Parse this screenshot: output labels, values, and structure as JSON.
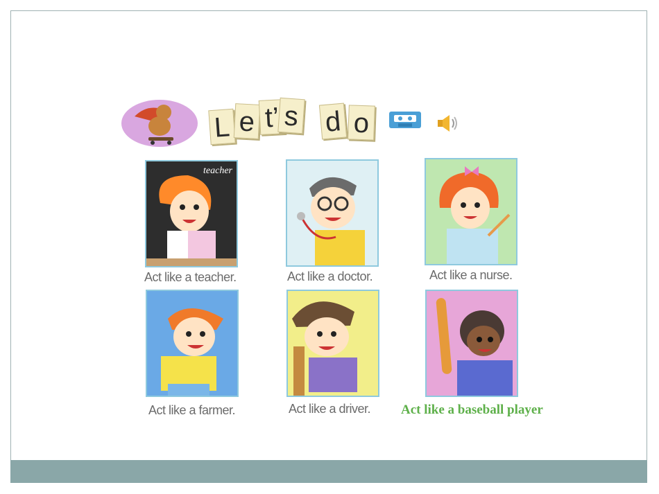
{
  "slide": {
    "title_tiles": [
      "L",
      "e",
      "t’",
      "s",
      "d",
      "o"
    ],
    "cards": [
      {
        "caption": "Act like a teacher.",
        "board_word": "teacher",
        "bg": "#2d2d2d"
      },
      {
        "caption": "Act like a doctor.",
        "bg": "#dff0f4"
      },
      {
        "caption": "Act like a nurse.",
        "bg": "#bfe7b0"
      },
      {
        "caption": "Act like a farmer.",
        "bg": "#6aa9e6"
      },
      {
        "caption": "Act like a driver.",
        "bg": "#f2ee8a"
      },
      {
        "caption": "",
        "bg": "#e7a6d8"
      }
    ],
    "green_caption": "Act like a baseball player"
  },
  "colors": {
    "footer": "#8aa7a8",
    "border": "#9fb1b2",
    "green_text": "#5eb04a",
    "card_border": "#8ec9de"
  }
}
